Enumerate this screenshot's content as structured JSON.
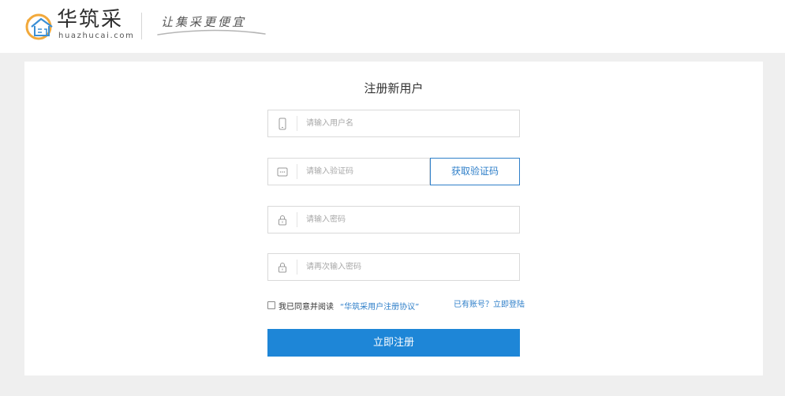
{
  "header": {
    "logo_cn": "华筑采",
    "logo_en": "huazhucai.com",
    "slogan": "让集采更便宜",
    "colors": {
      "logo_orange": "#f2a93b",
      "logo_blue": "#3a8fd6"
    }
  },
  "form": {
    "title": "注册新用户",
    "username": {
      "placeholder": "请输入用户名",
      "value": "",
      "icon": "phone-icon"
    },
    "verify_code": {
      "placeholder": "请输入验证码",
      "value": "",
      "icon": "message-icon"
    },
    "get_code_button": "获取验证码",
    "password": {
      "placeholder": "请输入密码",
      "value": "",
      "icon": "lock-icon"
    },
    "password_confirm": {
      "placeholder": "请再次输入密码",
      "value": "",
      "icon": "lock-icon"
    },
    "agree_text": "我已同意并阅读",
    "agreement_link": "“华筑采用户注册协议”",
    "agreed": false,
    "login_link": "已有账号？立即登陆",
    "submit_button": "立即注册",
    "colors": {
      "primary": "#1e86d7",
      "link": "#2f7fc9"
    }
  }
}
